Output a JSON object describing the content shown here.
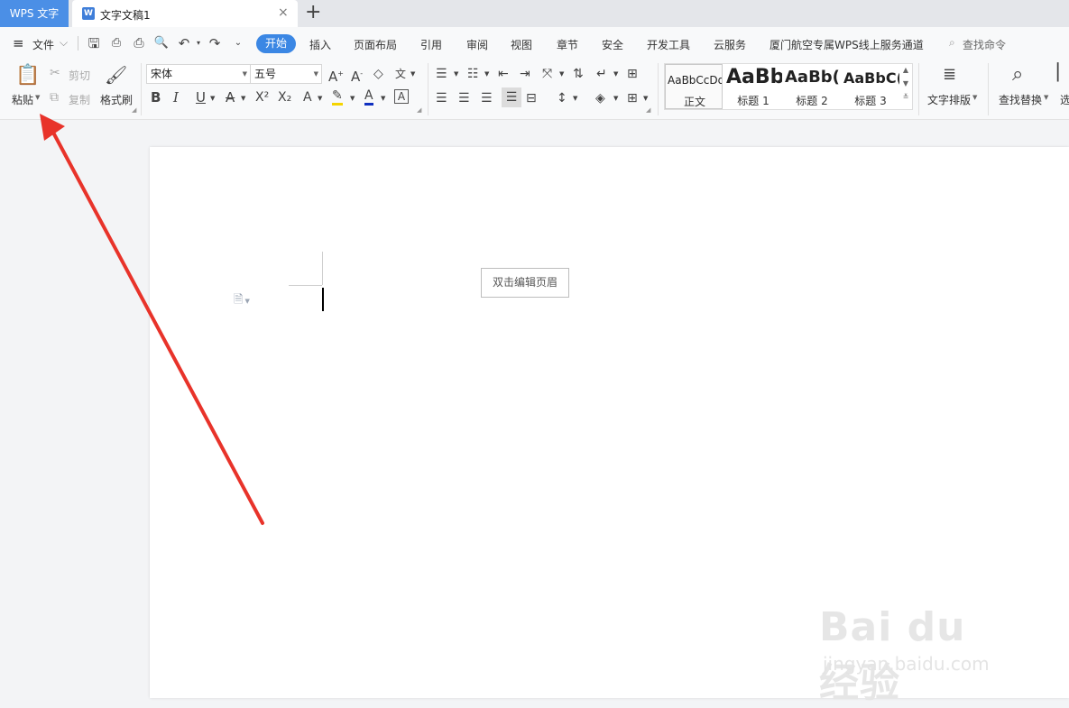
{
  "tabbar": {
    "app_label": "WPS 文字",
    "doc_tab": {
      "icon": "wps-writer-icon",
      "title": "文字文稿1",
      "close": "×"
    },
    "new_tab": "+"
  },
  "menubar": {
    "menu_label": "文件",
    "tabs": [
      "开始",
      "插入",
      "页面布局",
      "引用",
      "审阅",
      "视图",
      "章节",
      "安全",
      "开发工具",
      "云服务",
      "厦门航空专属WPS线上服务通道"
    ],
    "active_tab": "开始",
    "search_placeholder": "查找命令"
  },
  "ribbon": {
    "paste": "粘贴",
    "cut": "剪切",
    "copy": "复制",
    "format_painter": "格式刷",
    "font_name": "宋体",
    "font_size": "五号",
    "styles": [
      {
        "preview": "AaBbCcDd",
        "name": "正文"
      },
      {
        "preview": "AaBb",
        "name": "标题 1"
      },
      {
        "preview": "AaBb(",
        "name": "标题 2"
      },
      {
        "preview": "AaBbC(",
        "name": "标题 3"
      }
    ],
    "text_layout": "文字排版",
    "find_replace": "查找替换",
    "select_partial": "选"
  },
  "document": {
    "header_hint": "双击编辑页眉"
  },
  "watermark": {
    "brand": "Bai du 经验",
    "url": "jingyan.baidu.com"
  },
  "colors": {
    "accent": "#3b87e4",
    "app_tab": "#4b8fe6",
    "annotation_arrow": "#e8332a",
    "highlight_yellow": "#f5d400",
    "font_color_blue": "#1030c0"
  }
}
